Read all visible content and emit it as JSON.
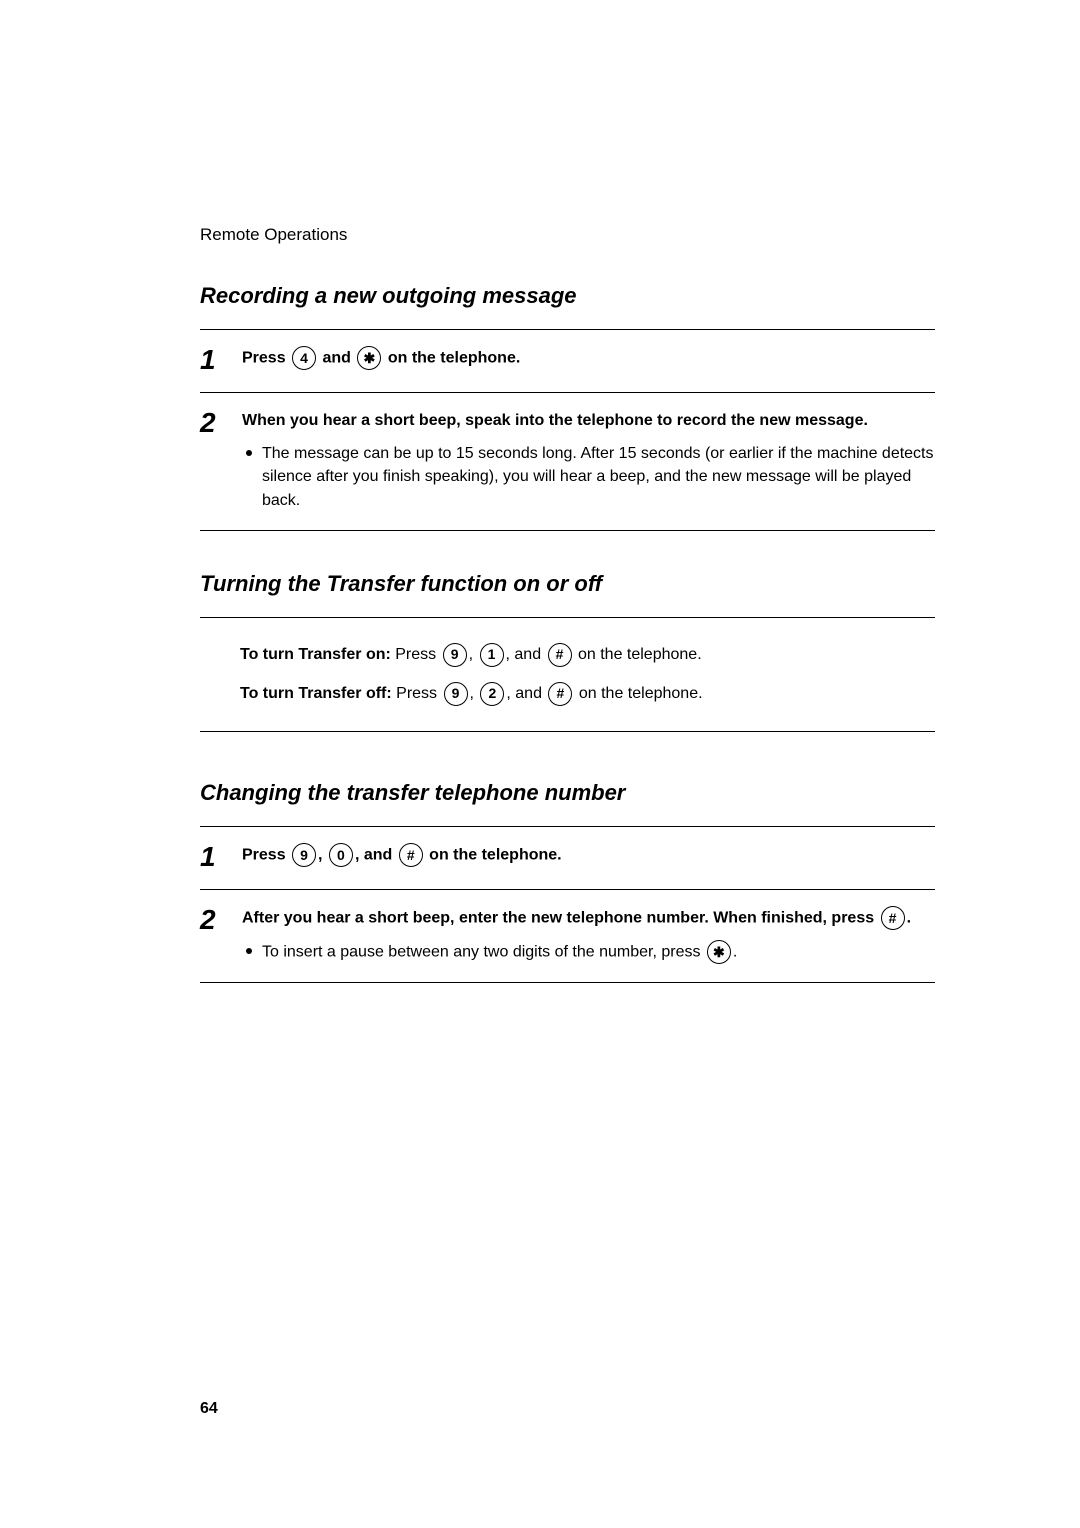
{
  "header": "Remote Operations",
  "section1": {
    "heading": "Recording a new outgoing message",
    "steps": [
      {
        "num": "1",
        "press_prefix": "Press ",
        "key1": "4",
        "and": " and ",
        "key2": "✱",
        "suffix": " on the telephone."
      },
      {
        "num": "2",
        "line": "When you hear a short beep, speak into the telephone to record the new message.",
        "bullet": "The message can be up to 15 seconds long. After 15 seconds (or earlier if the machine detects silence after you finish speaking), you will hear a beep, and the new message will be played back."
      }
    ]
  },
  "section2": {
    "heading": "Turning the Transfer function on or off",
    "lines": [
      {
        "label": "To turn Transfer on:",
        "press": " Press ",
        "k1": "9",
        "c1": ", ",
        "k2": "1",
        "c2": ", and ",
        "k3": "#",
        "suffix": " on the telephone."
      },
      {
        "label": "To turn Transfer off:",
        "press": " Press ",
        "k1": "9",
        "c1": ", ",
        "k2": "2",
        "c2": ", and ",
        "k3": "#",
        "suffix": " on the telephone."
      }
    ]
  },
  "section3": {
    "heading": "Changing the transfer telephone number",
    "steps": [
      {
        "num": "1",
        "press_prefix": "Press ",
        "k1": "9",
        "c1": ", ",
        "k2": "0",
        "c2": ", and ",
        "k3": "#",
        "suffix": " on the telephone."
      },
      {
        "num": "2",
        "line_prefix": "After you hear a short beep, enter the new telephone number. When finished, press ",
        "key": "#",
        "line_suffix": ".",
        "bullet_prefix": "To insert a pause between any two digits of the number, press ",
        "bullet_key": "✱",
        "bullet_suffix": "."
      }
    ]
  },
  "page_number": "64"
}
